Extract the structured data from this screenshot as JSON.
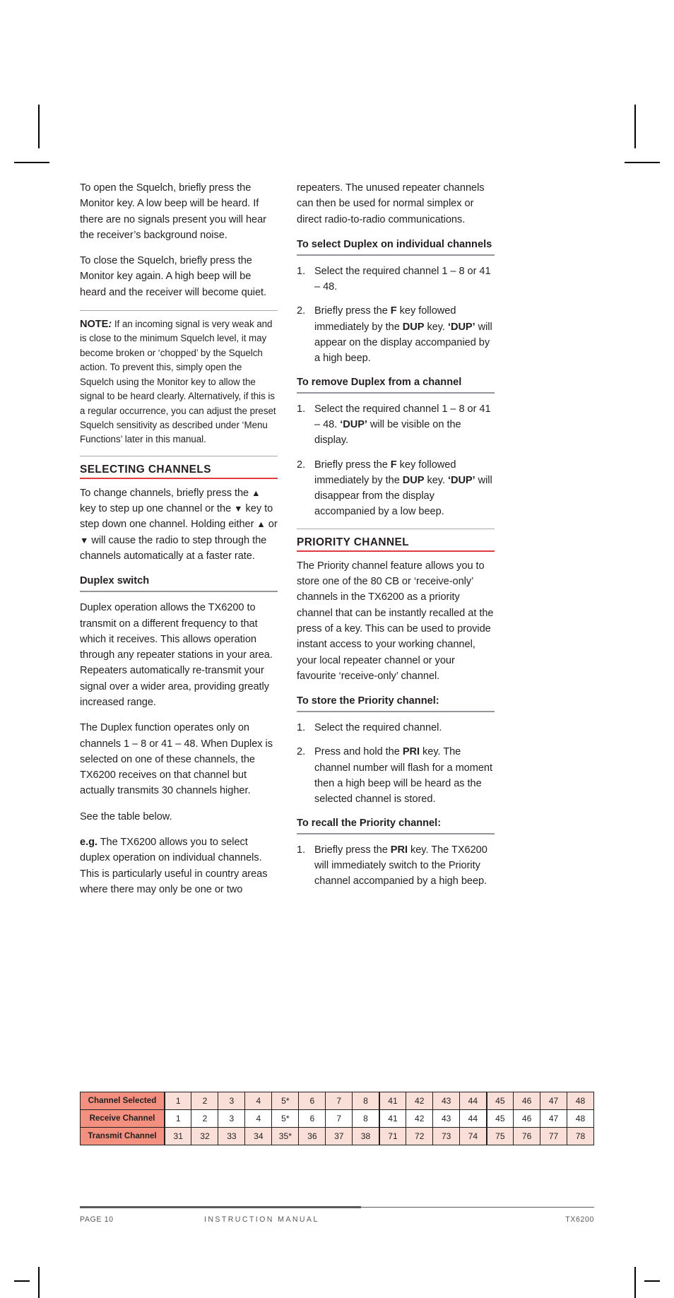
{
  "document": {
    "title": "TX6200 Instruction Manual Page 10"
  },
  "left_column": {
    "p1": "To open the Squelch, briefly press the Monitor key. A low beep will be heard. If there are no signals present you will hear the receiver’s background noise.",
    "p2": "To close the Squelch, briefly press the Monitor key again. A high beep will be heard and the receiver will become quiet.",
    "note": {
      "label": "NOTE",
      "colon": ":",
      "text": " If an incoming signal is very weak and is close to the minimum Squelch level, it may become broken or ‘chopped’ by the Squelch action. To prevent this, simply open the Squelch using the Monitor key to allow the signal to be heard clearly. Alternatively, if this is a regular occurrence, you can adjust the preset Squelch sensitivity as described under ‘Menu Functions’ later in this manual."
    },
    "section_heading": "SELECTING CHANNELS",
    "p3_a": "To change channels, briefly press the ",
    "p3_up": "▲",
    "p3_b": " key to step up one channel or the ",
    "p3_down": "▼",
    "p3_c": " key to step down one channel. Holding either ",
    "p3_d": " or ",
    "p3_e": " will cause the radio to step through the channels automatically at a faster rate.",
    "sub_heading": "Duplex switch",
    "p4": "Duplex operation allows the TX6200 to transmit on a different frequency to that which it receives. This allows operation through any repeater stations in your area. Repeaters automatically re-transmit your signal over a wider area, providing greatly increased range.",
    "p5": "The Duplex function operates only on channels 1 – 8 or 41 – 48. When Duplex is selected on one of these channels, the TX6200 receives on that channel but actually transmits 30 channels higher.",
    "p6": "See the table below.",
    "p7_lead": "e.g.",
    "p7": " The TX6200 allows you to select duplex operation on individual channels. This is particularly useful in country areas where there may only be one or two"
  },
  "right_column": {
    "p1": "repeaters. The unused repeater channels can then be used for normal simplex or direct radio-to-radio communications.",
    "sub_heading_1": "To select Duplex on individual channels",
    "steps_1": [
      {
        "parts": [
          {
            "t": "Select the required channel 1 – 8 or 41 – 48.",
            "b": false
          }
        ]
      },
      {
        "parts": [
          {
            "t": "Briefly press the ",
            "b": false
          },
          {
            "t": "F",
            "b": true
          },
          {
            "t": " key followed immediately by the ",
            "b": false
          },
          {
            "t": "DUP",
            "b": true
          },
          {
            "t": " key. ",
            "b": false
          },
          {
            "t": "‘DUP’",
            "b": true
          },
          {
            "t": " will appear on the display accompanied by a high beep.",
            "b": false
          }
        ]
      }
    ],
    "sub_heading_2": "To remove Duplex from a channel",
    "steps_2": [
      {
        "parts": [
          {
            "t": "Select the required channel 1 – 8 or 41 – 48. ",
            "b": false
          },
          {
            "t": "‘DUP’",
            "b": true
          },
          {
            "t": " will be visible on the display.",
            "b": false
          }
        ]
      },
      {
        "parts": [
          {
            "t": "Briefly press the ",
            "b": false
          },
          {
            "t": "F",
            "b": true
          },
          {
            "t": " key followed immediately by the ",
            "b": false
          },
          {
            "t": "DUP",
            "b": true
          },
          {
            "t": " key. ",
            "b": false
          },
          {
            "t": "‘DUP’",
            "b": true
          },
          {
            "t": " will disappear from the display accompanied by a low beep.",
            "b": false
          }
        ]
      }
    ],
    "section_heading": "PRIORITY CHANNEL",
    "p2": "The Priority channel feature allows you to store one of the 80 CB or ‘receive-only’ channels in the TX6200 as a priority channel that can be instantly recalled at the press of a key. This can be used to provide instant access to your working channel, your local repeater channel or your favourite ‘receive-only’ channel.",
    "sub_heading_3": "To store the Priority channel:",
    "steps_3": [
      {
        "parts": [
          {
            "t": "Select the required channel.",
            "b": false
          }
        ]
      },
      {
        "parts": [
          {
            "t": "Press and hold the ",
            "b": false
          },
          {
            "t": "PRI",
            "b": true
          },
          {
            "t": " key. The channel number will flash for a moment then a high beep will be heard as the selected channel is stored.",
            "b": false
          }
        ]
      }
    ],
    "sub_heading_4": "To recall the Priority channel:",
    "steps_4": [
      {
        "parts": [
          {
            "t": "Briefly press the ",
            "b": false
          },
          {
            "t": "PRI",
            "b": true
          },
          {
            "t": " key. The TX6200 will immediately switch to the Priority channel accompanied by a high beep.",
            "b": false
          }
        ]
      }
    ]
  },
  "channel_table": {
    "rows": [
      {
        "label": "Channel Selected",
        "shaded": true,
        "values": [
          "1",
          "2",
          "3",
          "4",
          "5*",
          "6",
          "7",
          "8",
          "41",
          "42",
          "43",
          "44",
          "45",
          "46",
          "47",
          "48"
        ]
      },
      {
        "label": "Receive Channel",
        "shaded": false,
        "values": [
          "1",
          "2",
          "3",
          "4",
          "5*",
          "6",
          "7",
          "8",
          "41",
          "42",
          "43",
          "44",
          "45",
          "46",
          "47",
          "48"
        ]
      },
      {
        "label": "Transmit Channel",
        "shaded": true,
        "values": [
          "31",
          "32",
          "33",
          "34",
          "35*",
          "36",
          "37",
          "38",
          "71",
          "72",
          "73",
          "74",
          "75",
          "76",
          "77",
          "78"
        ]
      }
    ],
    "group_break_indices": [
      8,
      12
    ],
    "colors": {
      "label_bg": "#f4907f",
      "shaded_bg": "#fadfd8",
      "border": "#231f20"
    }
  },
  "footer": {
    "page": "PAGE 10",
    "center": "INSTRUCTION MANUAL",
    "model": "TX6200"
  },
  "theme": {
    "accent_red": "#e03a3e",
    "rule_grey": "#939598",
    "text": "#231f20"
  }
}
